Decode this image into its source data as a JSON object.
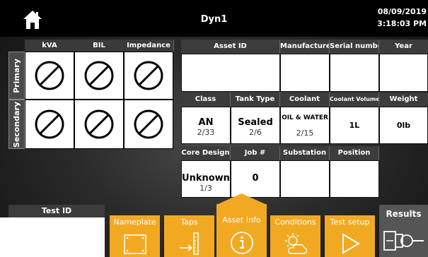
{
  "header": {
    "title": "Dyn1",
    "date": "08/09/2019",
    "time": "3:18:03 PM"
  },
  "left_grid": {
    "columns": [
      "kVA",
      "BIL",
      "Impedance"
    ],
    "rows": [
      "Primary",
      "Secondary"
    ]
  },
  "asset_table": {
    "row1_headers": [
      "Asset ID",
      "Manufacturer",
      "Serial number",
      "Year"
    ],
    "row1_values": [
      "",
      "",
      "",
      ""
    ],
    "row2_headers": [
      "Class",
      "Tank Type",
      "Coolant",
      "Coolant Volume",
      "Weight"
    ],
    "row2_values": [
      {
        "value": "AN",
        "sub": "2/33"
      },
      {
        "value": "Sealed",
        "sub": "2/6"
      },
      {
        "value": "OIL & WATER",
        "sub": "2/15"
      },
      {
        "value": "1L",
        "sub": ""
      },
      {
        "value": "0lb",
        "sub": ""
      }
    ],
    "row3_headers": [
      "Core Design",
      "Job #",
      "Substation",
      "Position"
    ],
    "row3_values": [
      {
        "value": "Unknown",
        "sub": "1/3"
      },
      {
        "value": "0",
        "sub": ""
      },
      {
        "value": "",
        "sub": ""
      },
      {
        "value": "",
        "sub": ""
      }
    ]
  },
  "bottom": {
    "test_id_label": "Test ID",
    "test_id_value": "",
    "tabs": [
      {
        "label": "Nameplate",
        "icon": "nameplate-icon"
      },
      {
        "label": "Taps",
        "icon": "taps-icon"
      },
      {
        "label": "Asset Info",
        "icon": "info-icon"
      },
      {
        "label": "Conditions",
        "icon": "weather-icon"
      },
      {
        "label": "Test setup",
        "icon": "play-icon"
      }
    ],
    "results_label": "Results"
  },
  "colors": {
    "accent": "#f2a922",
    "header_bg": "#3c3c3c"
  }
}
